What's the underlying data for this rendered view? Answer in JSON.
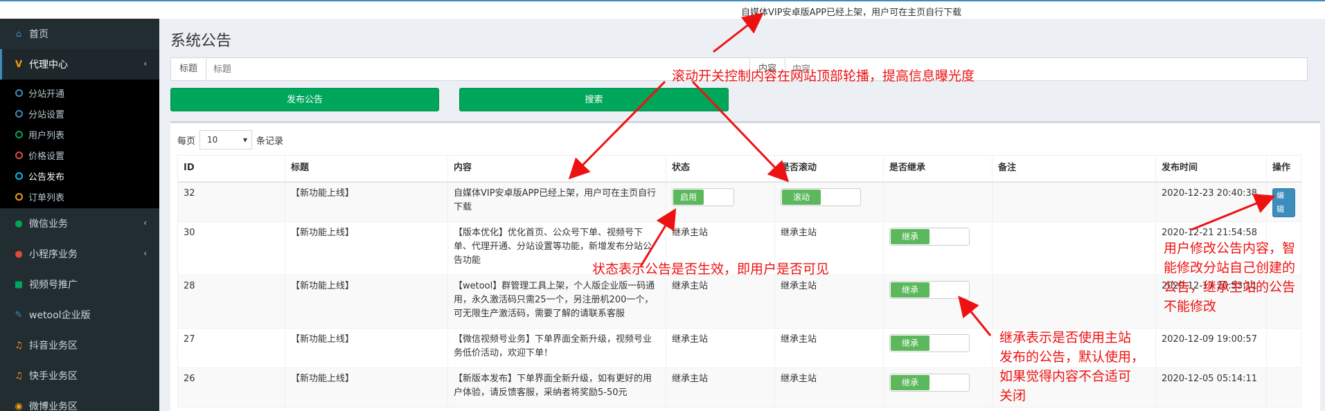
{
  "marquee": "自媒体VIP安卓版APP已经上架，用户可在主页自行下载",
  "sidebar": {
    "items": [
      {
        "label": "首页",
        "icon": "home-icon"
      },
      {
        "label": "代理中心",
        "icon": "v-icon"
      },
      {
        "label": "微信业务",
        "icon": "wechat-icon"
      },
      {
        "label": "小程序业务",
        "icon": "github-icon"
      },
      {
        "label": "视频号推广",
        "icon": "video-icon"
      },
      {
        "label": "wetool企业版",
        "icon": "wrench-icon"
      },
      {
        "label": "抖音业务区",
        "icon": "music-icon"
      },
      {
        "label": "快手业务区",
        "icon": "music-icon"
      },
      {
        "label": "微博业务区",
        "icon": "weibo-icon"
      }
    ],
    "submenu": [
      {
        "label": "分站开通",
        "color": "#3c8dbc"
      },
      {
        "label": "分站设置",
        "color": "#3c8dbc"
      },
      {
        "label": "用户列表",
        "color": "#00a65a"
      },
      {
        "label": "价格设置",
        "color": "#dd4b39"
      },
      {
        "label": "公告发布",
        "color": "#00c0ef"
      },
      {
        "label": "订单列表",
        "color": "#f39c12"
      }
    ]
  },
  "page": {
    "title": "系统公告"
  },
  "filters": {
    "title_label": "标题",
    "title_placeholder": "标题",
    "content_label": "内容",
    "content_placeholder": "内容"
  },
  "buttons": {
    "publish": "发布公告",
    "search": "搜索"
  },
  "length": {
    "prefix": "每页",
    "value": "10",
    "suffix": "条记录"
  },
  "table": {
    "headers": [
      "ID",
      "标题",
      "内容",
      "状态",
      "是否滚动",
      "是否继承",
      "备注",
      "发布时间",
      "操作"
    ],
    "enable_label": "启用",
    "scroll_label": "滚动",
    "inherit_label": "继承",
    "inherit_text": "继承主站",
    "edit_label": "编辑",
    "rows": [
      {
        "id": "32",
        "title": "【新功能上线】",
        "content": "自媒体VIP安卓版APP已经上架，用户可在主页自行下载",
        "time": "2020-12-23 20:40:38"
      },
      {
        "id": "30",
        "title": "【新功能上线】",
        "content": "【版本优化】优化首页、公众号下单、视频号下单、代理开通、分站设置等功能，新增发布分站公告功能",
        "time": "2020-12-21 21:54:58"
      },
      {
        "id": "28",
        "title": "【新功能上线】",
        "content": "【wetool】群管理工具上架，个人版企业版一码通用，永久激活码只需25一个，另注册机200一个，可无限生产激活码，需要了解的请联系客服",
        "time": "2020-12-17 20:53:11"
      },
      {
        "id": "27",
        "title": "【新功能上线】",
        "content": "【微信视频号业务】下单界面全新升级，视频号业务低价活动，欢迎下单！",
        "time": "2020-12-09 19:00:57"
      },
      {
        "id": "26",
        "title": "【新功能上线】",
        "content": "【新版本发布】下单界面全新升级，如有更好的用户体验，请反馈客服，采纳者将奖励5-50元",
        "time": "2020-12-05 05:14:11"
      }
    ]
  },
  "annotations": {
    "scroll": "滚动开关控制内容在网站顶部轮播，提高信息曝光度",
    "status": "状态表示公告是否生效，即用户是否可见",
    "inherit_1": "继承表示是否使用主站",
    "inherit_2": "发布的公告，默认使用，",
    "inherit_3": "如果觉得内容不合适可",
    "inherit_4": "关闭",
    "edit_1": "用户修改公告内容，智",
    "edit_2": "能修改分站自己创建的",
    "edit_3": "公告，继承主站的公告",
    "edit_4": "不能修改"
  }
}
